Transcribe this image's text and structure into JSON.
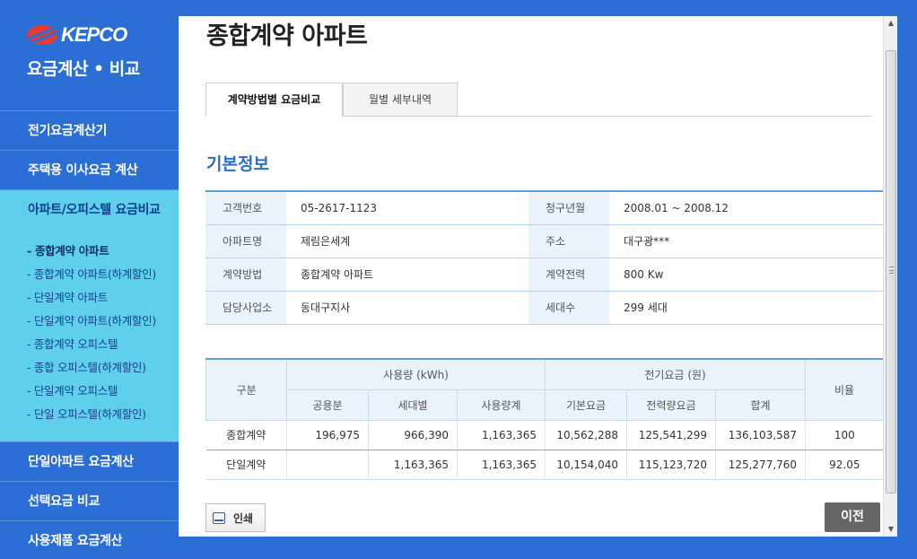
{
  "brand": {
    "logo_text": "KEPCO",
    "app_title": "요금계산 • 비교"
  },
  "sidebar": {
    "items": [
      {
        "label": "전기요금계산기"
      },
      {
        "label": "주택용 이사요금 계산"
      },
      {
        "label": "아파트/오피스텔 요금비교"
      }
    ],
    "submenu": [
      {
        "label": "- 종합계약 아파트"
      },
      {
        "label": "- 종합계약 아파트(하계할인)"
      },
      {
        "label": "- 단일계약 아파트"
      },
      {
        "label": "- 단일계약 아파트(하계할인)"
      },
      {
        "label": "- 종합계약 오피스텔"
      },
      {
        "label": "- 종합 오피스텔(하계할인)"
      },
      {
        "label": "- 단일계약 오피스텔"
      },
      {
        "label": "- 단일 오피스텔(하계할인)"
      }
    ],
    "bottom_items": [
      {
        "label": "단일아파트 요금계산"
      },
      {
        "label": "선택요금 비교"
      },
      {
        "label": "사용제품 요금계산"
      }
    ]
  },
  "main": {
    "title": "종합계약 아파트",
    "tabs": [
      {
        "label": "계약방법별 요금비교"
      },
      {
        "label": "월별 세부내역"
      }
    ],
    "section_title": "기본정보",
    "info": [
      {
        "label": "고객번호",
        "value": "05-2617-1123",
        "label2": "청구년월",
        "value2": "2008.01 ~ 2008.12"
      },
      {
        "label": "아파트명",
        "value": "제림은세계",
        "label2": "주소",
        "value2": "대구광***"
      },
      {
        "label": "계약방법",
        "value": "종합계약 아파트",
        "label2": "계약전력",
        "value2": "800 Kw"
      },
      {
        "label": "담당사업소",
        "value": "동대구지사",
        "label2": "세대수",
        "value2": "299 세대"
      }
    ],
    "usage_table": {
      "header_category": "구분",
      "header_usage": "사용량 (kWh)",
      "header_fee": "전기요금 (원)",
      "header_ratio": "비율",
      "sub_headers": [
        "공용분",
        "세대별",
        "사용량계",
        "기본요금",
        "전력량요금",
        "합계"
      ],
      "rows": [
        {
          "name": "종합계약",
          "cells": [
            "196,975",
            "966,390",
            "1,163,365",
            "10,562,288",
            "125,541,299",
            "136,103,587"
          ],
          "ratio": "100"
        },
        {
          "name": "단일계약",
          "cells": [
            "",
            "1,163,365",
            "1,163,365",
            "10,154,040",
            "115,123,720",
            "125,277,760"
          ],
          "ratio": "92.05"
        }
      ]
    },
    "print_label": "인쇄",
    "prev_label": "이전"
  }
}
